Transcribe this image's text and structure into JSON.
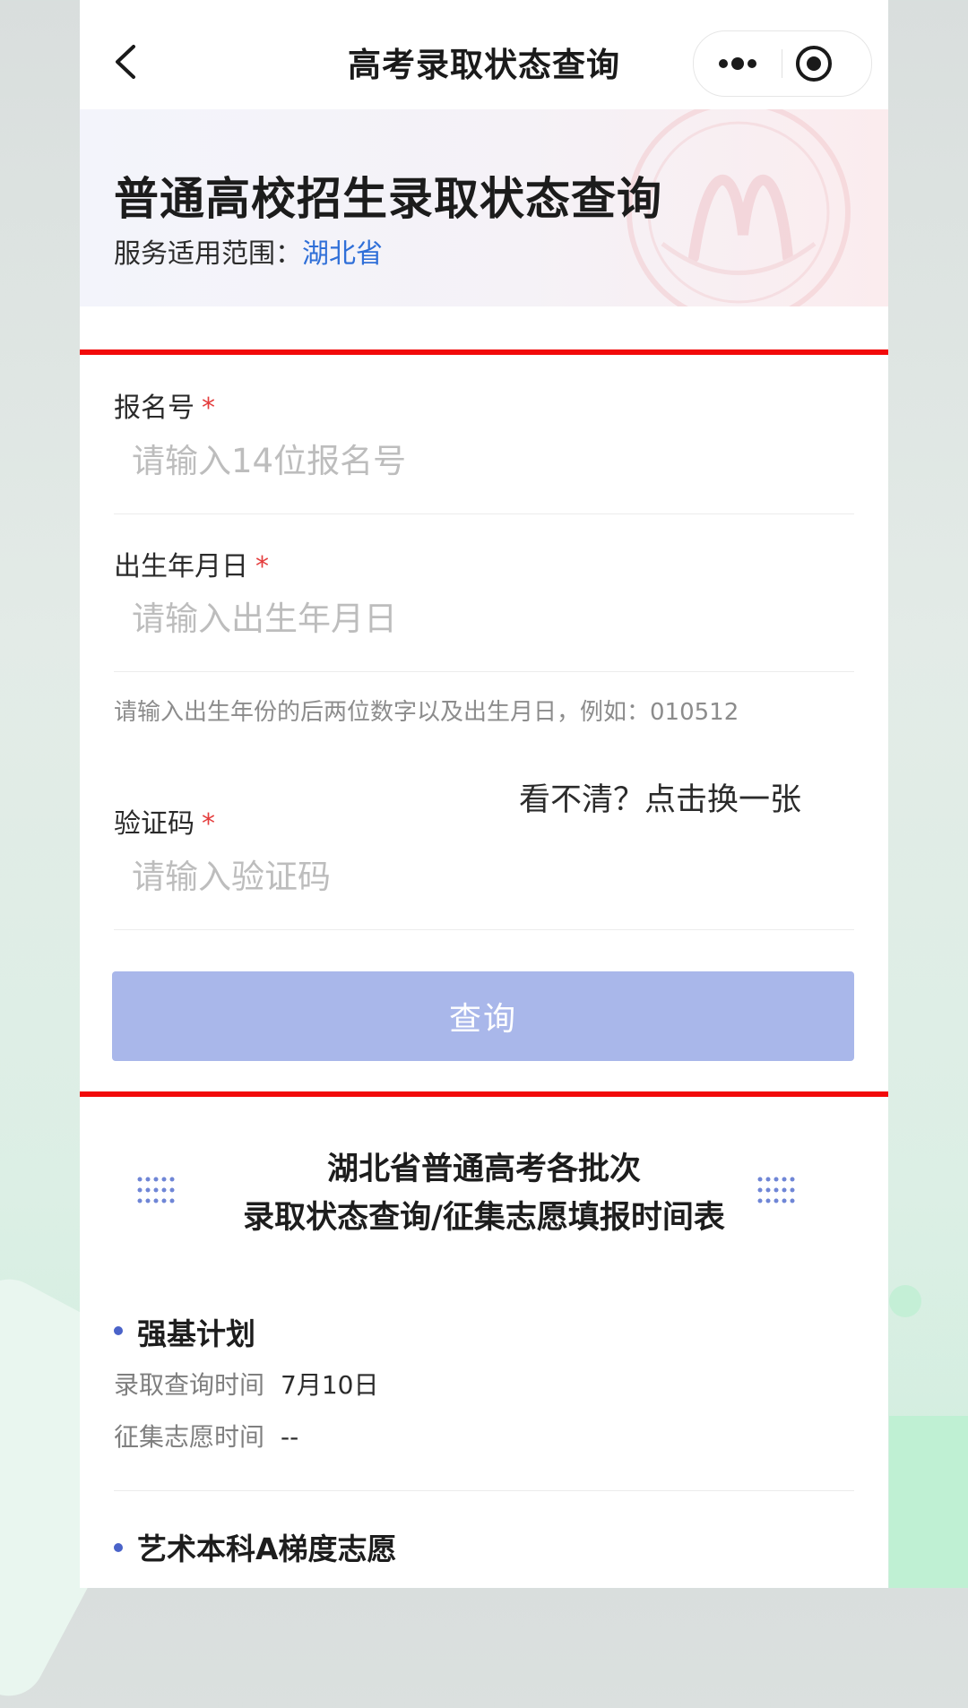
{
  "nav": {
    "title": "高考录取状态查询"
  },
  "banner": {
    "title": "普通高校招生录取状态查询",
    "scope_label": "服务适用范围：",
    "scope_value": "湖北省"
  },
  "form": {
    "reg_no": {
      "label": "报名号",
      "required_mark": "*",
      "placeholder": "请输入14位报名号",
      "value": ""
    },
    "birth": {
      "label": "出生年月日",
      "required_mark": "*",
      "placeholder": "请输入出生年月日",
      "value": ""
    },
    "birth_hint": "请输入出生年份的后两位数字以及出生月日，例如：010512",
    "captcha": {
      "label": "验证码",
      "required_mark": "*",
      "placeholder": "请输入验证码",
      "value": "",
      "refresh_text": "看不清？点击换一张"
    },
    "submit_label": "查询"
  },
  "schedule": {
    "title_line1": "湖北省普通高考各批次",
    "title_line2": "录取状态查询/征集志愿填报时间表",
    "items": [
      {
        "name": "强基计划",
        "query_label": "录取查询时间",
        "query_value": "7月10日",
        "collect_label": "征集志愿时间",
        "collect_value": "--"
      },
      {
        "name": "艺术本科A梯度志愿"
      }
    ]
  },
  "colors": {
    "accent": "#2f6fd8",
    "button_disabled": "#a9b7ea",
    "required": "#e43d3d",
    "highlight_box": "#f20a0a",
    "bullet": "#4a63c9"
  },
  "icons": [
    "back-arrow-icon",
    "more-dots-icon",
    "close-target-icon",
    "seal-watermark-icon",
    "dot-grid-icon"
  ]
}
